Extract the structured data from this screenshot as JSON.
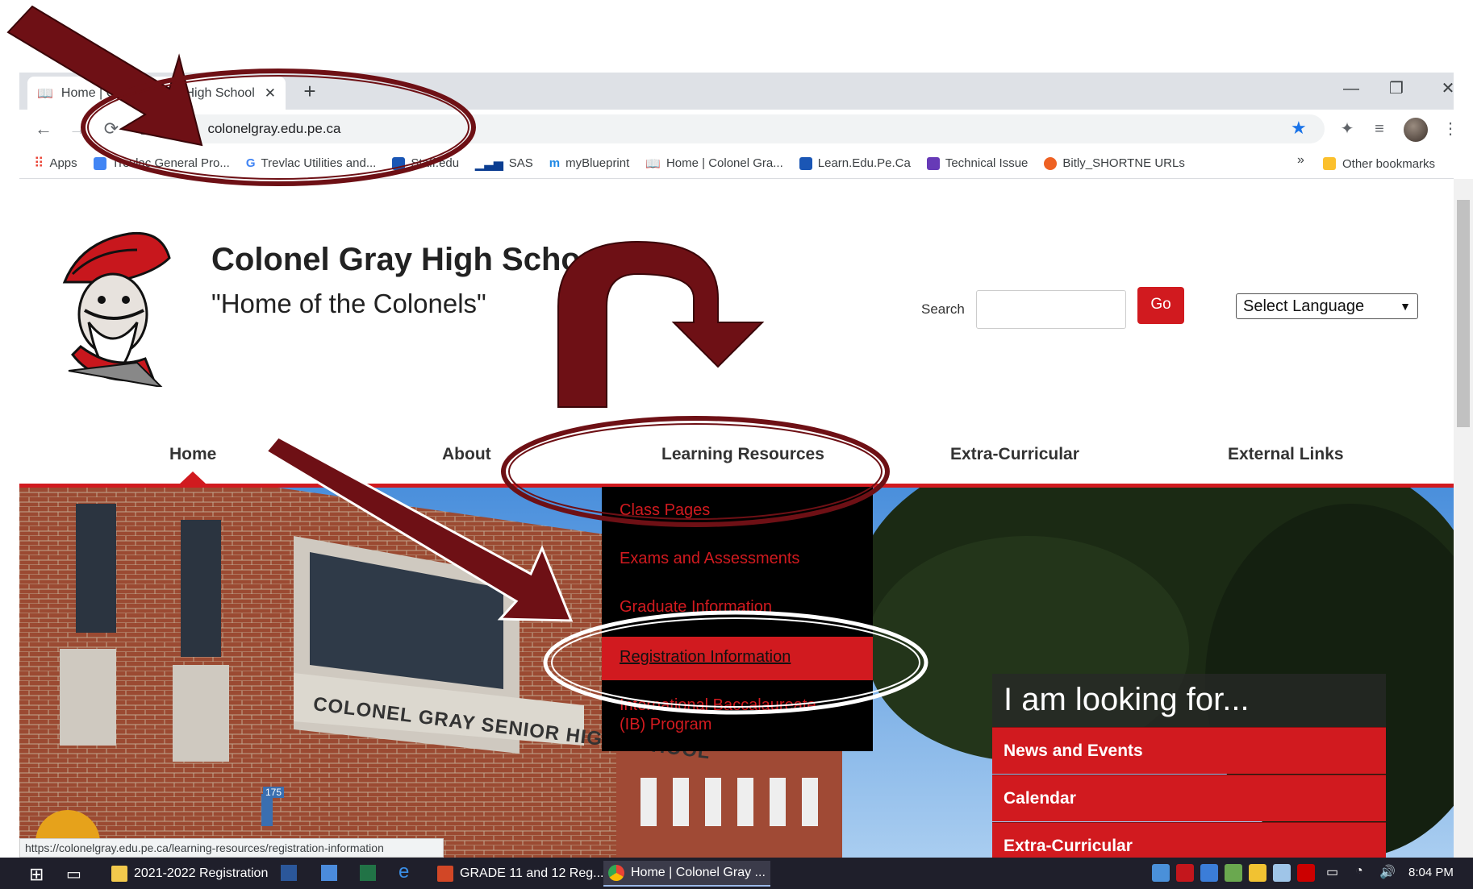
{
  "browser": {
    "tab_title": "Home | Colonel Gray High School",
    "new_tab": "+",
    "tab_close": "✕",
    "url": "colonelgray.edu.pe.ca",
    "window_minimize": "—",
    "window_restore": "❐",
    "window_close": "✕",
    "bookmarks": [
      {
        "label": "Apps",
        "color": "#ea4335"
      },
      {
        "label": "Trevlac General Pro...",
        "color": "#4285f4"
      },
      {
        "label": "Trevlac Utilities and...",
        "color": "#34a853"
      },
      {
        "label": "Staff.edu",
        "color": "#1a56b5"
      },
      {
        "label": "SAS",
        "color": "#0b3d91"
      },
      {
        "label": "myBlueprint",
        "color": "#1e88e5"
      },
      {
        "label": "Home | Colonel Gra...",
        "color": "#5f6368"
      },
      {
        "label": "Learn.Edu.Pe.Ca",
        "color": "#1a56b5"
      },
      {
        "label": "Technical Issue",
        "color": "#673ab7"
      },
      {
        "label": "Bitly_SHORTNE URLs",
        "color": "#ee6123"
      }
    ],
    "bookmarks_more": "»",
    "other_bookmarks": "Other bookmarks",
    "status_url": "https://colonelgray.edu.pe.ca/learning-resources/registration-information"
  },
  "site": {
    "name": "Colonel Gray High School",
    "motto": "\"Home of the Colonels\"",
    "search_label": "Search",
    "search_value": "",
    "go_label": "Go",
    "language_select": "Select Language",
    "nav": [
      "Home",
      "About",
      "Learning Resources",
      "Extra-Curricular",
      "External Links"
    ],
    "dropdown": [
      "Class Pages",
      "Exams and Assessments",
      "Graduate Information",
      "Registration Information",
      "International Baccalaureate",
      "(IB) Program"
    ],
    "building_sign": "COLONEL GRAY SENIOR HIGH SCHOOL",
    "building_number": "175",
    "looking_for": {
      "title": "I am looking for...",
      "items": [
        "News and Events",
        "Calendar",
        "Extra-Curricular"
      ]
    },
    "colors": {
      "accent": "#d11a1f",
      "annotation": "#6e1015"
    }
  },
  "taskbar": {
    "items": [
      "2021-2022 Registration",
      "GRADE 11 and 12 Reg...",
      "Home | Colonel Gray ..."
    ],
    "clock": "8:04 PM"
  }
}
